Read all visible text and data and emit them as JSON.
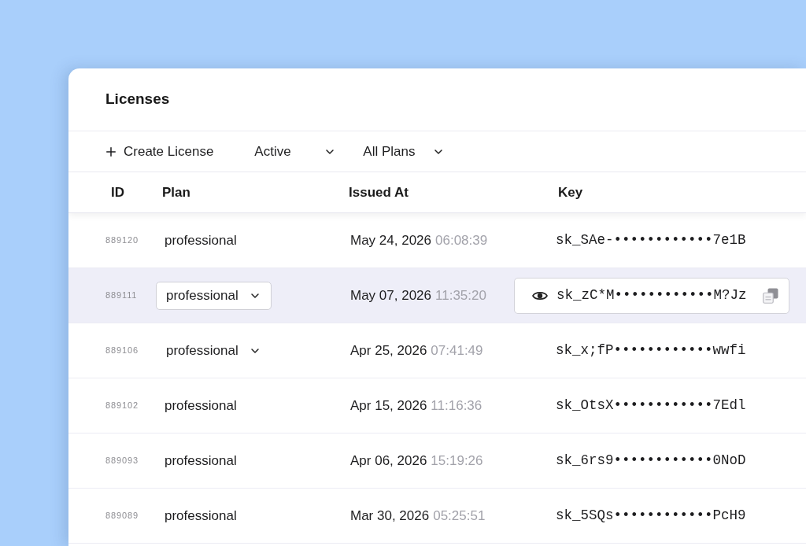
{
  "panel": {
    "title": "Licenses"
  },
  "toolbar": {
    "create_button": "Create License",
    "filters": [
      {
        "label": "Active"
      },
      {
        "label": "All Plans"
      }
    ]
  },
  "table": {
    "columns": [
      "ID",
      "Plan",
      "Issued At",
      "Key"
    ],
    "rows": [
      {
        "id": "889120",
        "selected": false,
        "plan": {
          "value": "professional",
          "kind": "text"
        },
        "date": "May 24, 2026",
        "time": "06:08:39",
        "key": {
          "value": "sk_SAe-••••••••••••7e1B",
          "kind": "text"
        }
      },
      {
        "id": "889111",
        "selected": true,
        "plan": {
          "value": "professional",
          "kind": "select"
        },
        "date": "May 07, 2026",
        "time": "11:35:20",
        "key": {
          "value": "sk_zC*M••••••••••••M?Jz",
          "kind": "field"
        }
      },
      {
        "id": "889106",
        "selected": false,
        "plan": {
          "value": "professional",
          "kind": "caret"
        },
        "date": "Apr 25, 2026",
        "time": "07:41:49",
        "key": {
          "value": "sk_x;fP••••••••••••wwfi",
          "kind": "text"
        }
      },
      {
        "id": "889102",
        "selected": false,
        "plan": {
          "value": "professional",
          "kind": "text"
        },
        "date": "Apr 15, 2026",
        "time": "11:16:36",
        "key": {
          "value": "sk_OtsX••••••••••••7Edl",
          "kind": "text"
        }
      },
      {
        "id": "889093",
        "selected": false,
        "plan": {
          "value": "professional",
          "kind": "text"
        },
        "date": "Apr 06, 2026",
        "time": "15:19:26",
        "key": {
          "value": "sk_6rs9••••••••••••0NoD",
          "kind": "text"
        }
      },
      {
        "id": "889089",
        "selected": false,
        "plan": {
          "value": "professional",
          "kind": "text"
        },
        "date": "Mar 30, 2026",
        "time": "05:25:51",
        "key": {
          "value": "sk_5SQs••••••••••••PcH9",
          "kind": "text"
        }
      }
    ]
  }
}
